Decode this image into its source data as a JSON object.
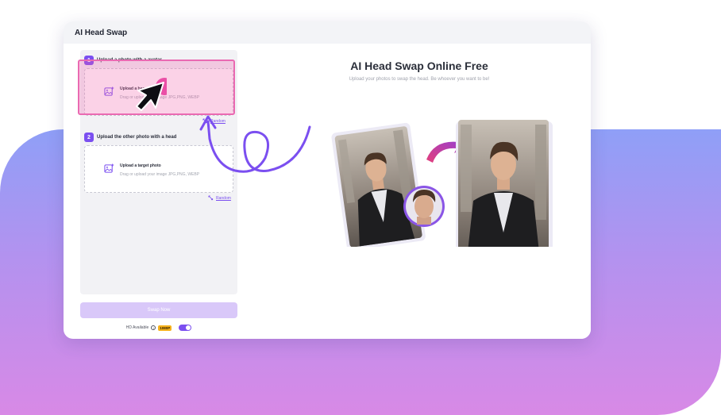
{
  "app": {
    "title": "AI Head Swap"
  },
  "upload_base": {
    "step_number": "1",
    "step_label": "Upload a photo with a avatar",
    "title": "Upload a base p",
    "subtitle": "Drag or upload your image JPG,PNG, WEBP",
    "random_label": "Random"
  },
  "upload_target": {
    "step_number": "2",
    "step_label": "Upload the other photo with a head",
    "title": "Upload a target photo",
    "subtitle": "Drag or upload your image JPG,PNG, WEBP",
    "random_label": "Random"
  },
  "actions": {
    "swap_label": "Swap Now",
    "hd_label": "HD Available",
    "info_icon": "i",
    "hd_badge": "1080P",
    "hd_enabled": true
  },
  "hero": {
    "title": "AI Head Swap Online Free",
    "subtitle": "Upload your photos to swap the head. Be whoever you want to be!"
  },
  "colors": {
    "accent": "#7b4ff0",
    "highlight": "#ea6ab2",
    "badge": "#f6b21c",
    "gradient_top": "#8f9ff7",
    "gradient_bottom": "#d889e6"
  },
  "icons": [
    "image-upload-icon",
    "random-icon",
    "info-icon",
    "pointer-cursor-icon",
    "swap-arrow-icon",
    "swirl-arrow-icon"
  ]
}
